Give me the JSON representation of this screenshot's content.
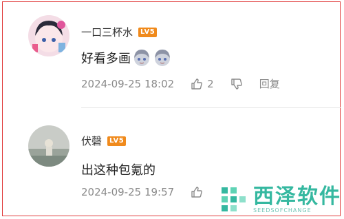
{
  "comments": [
    {
      "username": "一口三杯水",
      "level": "LV5",
      "text": "好看多画",
      "timestamp": "2024-09-25 18:02",
      "like_count": "2",
      "reply_label": "回复"
    },
    {
      "username": "伏磬",
      "level": "LV5",
      "text": "出这种包氪的",
      "timestamp": "2024-09-25 19:57"
    }
  ],
  "watermark": {
    "title": "西泽软件",
    "subtitle": "SEEDSOFCHANGE"
  },
  "colors": {
    "level_badge": "#f08a1c",
    "border": "#e03a3a",
    "watermark": "#35b8a0"
  },
  "icons": [
    "thumb-up-icon",
    "thumb-down-icon",
    "sticker-emoji-icon"
  ]
}
